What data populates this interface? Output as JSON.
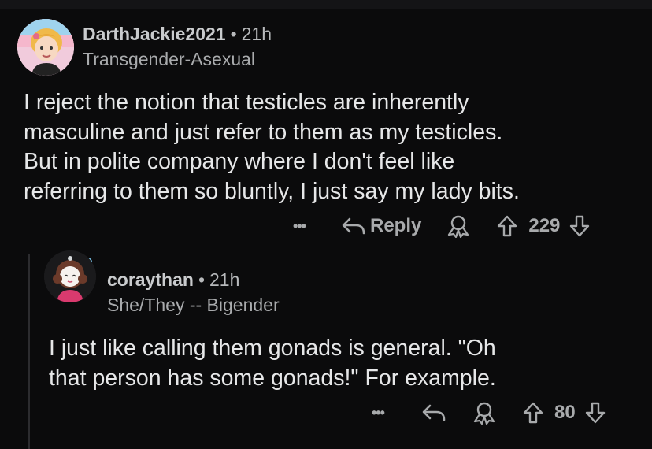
{
  "comments": [
    {
      "username": "DarthJackie2021",
      "separator": "•",
      "time": "21h",
      "flair": "Transgender-Asexual",
      "body_lines": [
        "I reject the notion that testicles are inherently",
        "masculine and just refer to them as my testicles.",
        "But in polite company where I don't feel like",
        "referring to them so bluntly, I just say my lady bits."
      ],
      "actions": {
        "more": "•••",
        "reply_label": "Reply",
        "score": "229"
      }
    },
    {
      "username": "coraythan",
      "separator": "•",
      "time": "21h",
      "flair": "She/They -- Bigender",
      "body_lines": [
        "I just like calling them gonads is general. \"Oh",
        "that person has some gonads!\" For example."
      ],
      "actions": {
        "more": "•••",
        "score": "80"
      }
    }
  ],
  "colors": {
    "background": "#0b0b0c",
    "text": "#e6e7e8",
    "muted": "#a8aaac"
  },
  "icons": [
    "avatar-illustration",
    "reply-arrow-icon",
    "award-icon",
    "upvote-icon",
    "downvote-icon",
    "more-icon"
  ]
}
